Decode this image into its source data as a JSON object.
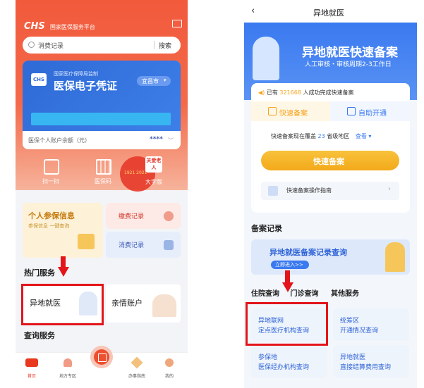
{
  "left": {
    "brand": {
      "logo": "CHS",
      "title": "国家医保服务平台"
    },
    "search": {
      "placeholder": "消费记录",
      "button": "搜索"
    },
    "card": {
      "supervisor": "国家医疗保障局监制",
      "title": "医保电子凭证",
      "city": "宜昌市",
      "balance_label": "医保个人账户余额（元）",
      "balance_mask": "****"
    },
    "quick_actions": [
      {
        "label": "扫一扫",
        "icon": "scan-icon"
      },
      {
        "label": "医保码",
        "icon": "qr-code-icon"
      },
      {
        "label": "大字版",
        "icon": "elderly-care-icon",
        "badge": "关爱老人"
      }
    ],
    "party_badge": "1921 2021",
    "info_card": {
      "title": "个人参保信息",
      "subtitle": "参保信息 一键查询"
    },
    "records": [
      {
        "label": "缴费记录"
      },
      {
        "label": "消费记录"
      }
    ],
    "hot_services_title": "热门服务",
    "services": [
      {
        "label": "异地就医"
      },
      {
        "label": "亲情账户"
      }
    ],
    "query_title": "查询服务",
    "nav": [
      {
        "label": "首页",
        "icon": "home-icon"
      },
      {
        "label": "地方专区",
        "icon": "local-area-icon"
      },
      {
        "label": "",
        "icon": "qr-code-icon"
      },
      {
        "label": "办事指南",
        "icon": "guide-icon"
      },
      {
        "label": "我的",
        "icon": "profile-icon"
      }
    ]
  },
  "right": {
    "header": {
      "title": "异地就医"
    },
    "banner": {
      "title": "异地就医快速备案",
      "subtitle": "人工审核・审核周期2-3工作日"
    },
    "notice": {
      "prefix": "已有",
      "count": "321668",
      "suffix": "人成功完成快速备案"
    },
    "tabs": [
      {
        "label": "快速备案",
        "active": true
      },
      {
        "label": "自助开通",
        "active": false
      }
    ],
    "coverage": {
      "text_before": "快速备案现在覆盖",
      "count": "23",
      "text_after": "省级地区",
      "view": "查看"
    },
    "primary_button": "快速备案",
    "guide": "快速备案操作指南",
    "records_title": "备案记录",
    "records_banner": {
      "title": "异地就医备案记录查询",
      "cta": "立即进入>>"
    },
    "section_tabs": [
      "住院查询",
      "门诊查询",
      "其他服务"
    ],
    "tiles": [
      {
        "line1": "异地联网",
        "line2": "定点医疗机构查询"
      },
      {
        "line1": "统筹区",
        "line2": "开通情况查询"
      },
      {
        "line1": "参保地",
        "line2": "医保经办机构查询"
      },
      {
        "line1": "异地就医",
        "line2": "直接结算费用查询"
      }
    ]
  },
  "colors": {
    "brand_red": "#f25a3c",
    "accent_blue": "#3a79f0",
    "highlight_red": "#e3151a",
    "gold": "#f6b21b"
  }
}
